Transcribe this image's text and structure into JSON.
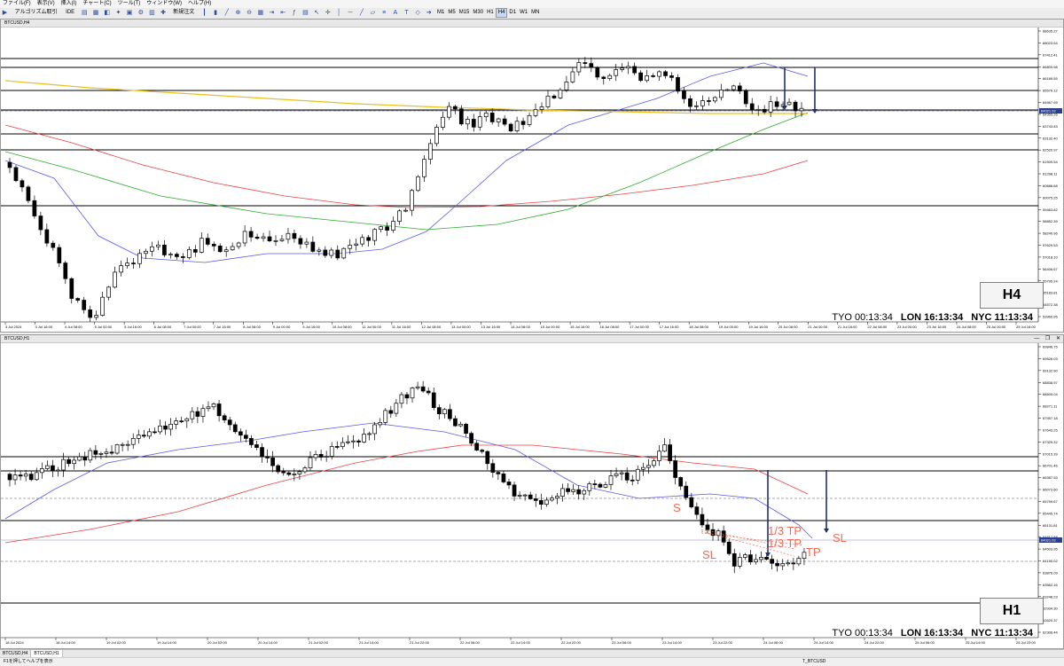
{
  "menu": [
    "ファイル(F)",
    "表示(V)",
    "挿入(I)",
    "チャート(C)",
    "ツール(T)",
    "ウィンドウ(W)",
    "ヘルプ(H)"
  ],
  "toolbar": {
    "algo_label": "アルゴリズム取引",
    "ide_label": "IDE",
    "new_order_label": "新規注文",
    "timeframes": [
      "M1",
      "M5",
      "M15",
      "M30",
      "H1",
      "H4",
      "D1",
      "W1",
      "MN"
    ],
    "active_timeframe": "H4"
  },
  "chart_top": {
    "title": "BTCUSD,H4",
    "timeframe_badge": "H4",
    "clock": {
      "tyo": "TYO 00:13:34",
      "lon": "LON 16:13:34",
      "nyc": "NYC 11:13:34"
    },
    "price_labels": [
      "68635.27",
      "68023.64",
      "67412.41",
      "66800.98",
      "66189.55",
      "65579.12",
      "64967.69",
      "64355.26",
      "63743.83",
      "63132.40",
      "62520.97",
      "61909.54",
      "61298.11",
      "60686.68",
      "60075.25",
      "59463.82",
      "58852.39",
      "58240.96",
      "57629.53",
      "57018.10",
      "56406.67",
      "55795.24",
      "55183.81",
      "54572.38",
      "53960.95"
    ],
    "current_price": "64021.02",
    "time_labels": [
      "3 Jul 2024",
      "3 Jul 16:00",
      "4 Jul 08:00",
      "5 Jul 00:00",
      "5 Jul 16:00",
      "6 Jul 08:00",
      "7 Jul 00:00",
      "7 Jul 16:00",
      "8 Jul 08:00",
      "9 Jul 00:00",
      "9 Jul 16:00",
      "10 Jul 08:00",
      "11 Jul 00:00",
      "11 Jul 16:00",
      "12 Jul 08:00",
      "13 Jul 00:00",
      "13 Jul 16:00",
      "14 Jul 08:00",
      "15 Jul 00:00",
      "15 Jul 16:00",
      "16 Jul 08:00",
      "17 Jul 00:00",
      "17 Jul 16:00",
      "18 Jul 08:00",
      "19 Jul 00:00",
      "19 Jul 16:00",
      "20 Jul 08:00",
      "21 Jul 00:00",
      "21 Jul 16:00",
      "22 Jul 08:00",
      "23 Jul 00:00",
      "23 Jul 16:00",
      "24 Jul 08:00",
      "25 Jul 00:00",
      "25 Jul 16:00"
    ]
  },
  "chart_bottom": {
    "title": "BTCUSD,H1",
    "timeframe_badge": "H1",
    "clock": {
      "tyo": "TYO 00:13:34",
      "lon": "LON 16:13:34",
      "nyc": "NYC 11:13:34"
    },
    "price_labels": [
      "69846.75",
      "69526.03",
      "69132.90",
      "68838.97",
      "68505.04",
      "68271.11",
      "67957.18",
      "67643.25",
      "67329.32",
      "67015.39",
      "66701.46",
      "66387.53",
      "66073.60",
      "65759.67",
      "65445.74",
      "65131.81",
      "64817.88",
      "64503.95",
      "64190.02",
      "63876.09",
      "63562.16",
      "63248.23",
      "62934.30",
      "62620.37",
      "62306.44"
    ],
    "current_price": "64021.02",
    "time_labels": [
      "18 Jul 2024",
      "18 Jul 14:00",
      "19 Jul 02:00",
      "19 Jul 14:00",
      "20 Jul 02:00",
      "20 Jul 14:00",
      "21 Jul 02:00",
      "21 Jul 14:00",
      "21 Jul 22:00",
      "22 Jul 06:00",
      "22 Jul 14:00",
      "22 Jul 22:00",
      "23 Jul 06:00",
      "23 Jul 14:00",
      "23 Jul 22:00",
      "24 Jul 06:00",
      "24 Jul 14:00",
      "24 Jul 22:00",
      "25 Jul 06:00",
      "25 Jul 14:00",
      "25 Jul 22:00"
    ],
    "annotations": {
      "tp1": "1/3 TP",
      "tp2": "1/3 TP",
      "tp3": "TP",
      "sl1": "SL",
      "sl2": "SL",
      "s": "S"
    }
  },
  "tabs": [
    "BTCUSD,H4",
    "BTCUSD,H1"
  ],
  "active_tab": "BTCUSD,H1",
  "status": {
    "left": "F1を押してヘルプを表示",
    "right": "T_BTCUSD"
  },
  "colors": {
    "ma_blue": "#5a5ae8",
    "ma_red": "#e84040",
    "ma_green": "#2faa2f",
    "ma_yellow": "#e8c020",
    "arrow": "#22306e",
    "annotation": "#ef6a55"
  }
}
